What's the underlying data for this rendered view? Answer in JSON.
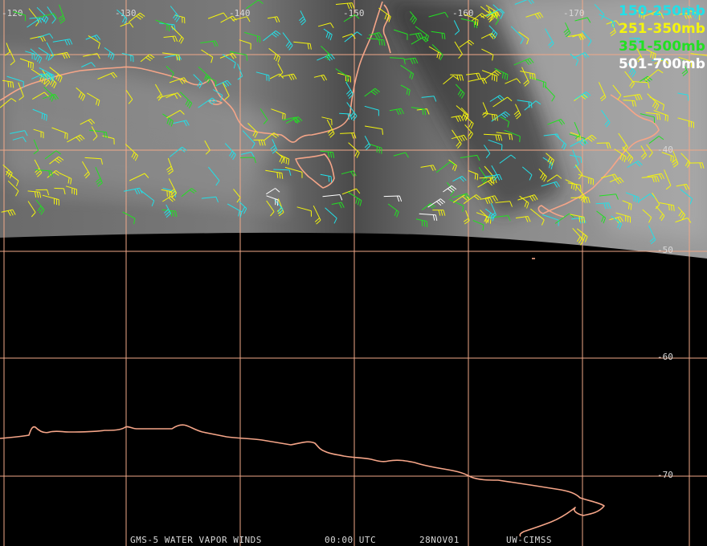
{
  "longitude_labels": [
    "-120",
    "-130",
    "-140",
    "-150",
    "-160",
    "-170"
  ],
  "latitude_labels": [
    "-40",
    "-50",
    "-60",
    "-70"
  ],
  "legend": [
    {
      "label": "150-250mb",
      "color": "#22e0e8"
    },
    {
      "label": "251-350mb",
      "color": "#f4f40e"
    },
    {
      "label": "351-500mb",
      "color": "#22e022"
    },
    {
      "label": "501-700mb",
      "color": "#ffffff"
    }
  ],
  "footer": {
    "satellite": "GMS-5 WATER VAPOR WINDS",
    "time": "00:00 UTC",
    "date": "28NOV01",
    "source": "UW-CIMSS"
  },
  "colors": {
    "grid": "#f0a888",
    "coastline": "#f5a588",
    "background": "#000000"
  }
}
